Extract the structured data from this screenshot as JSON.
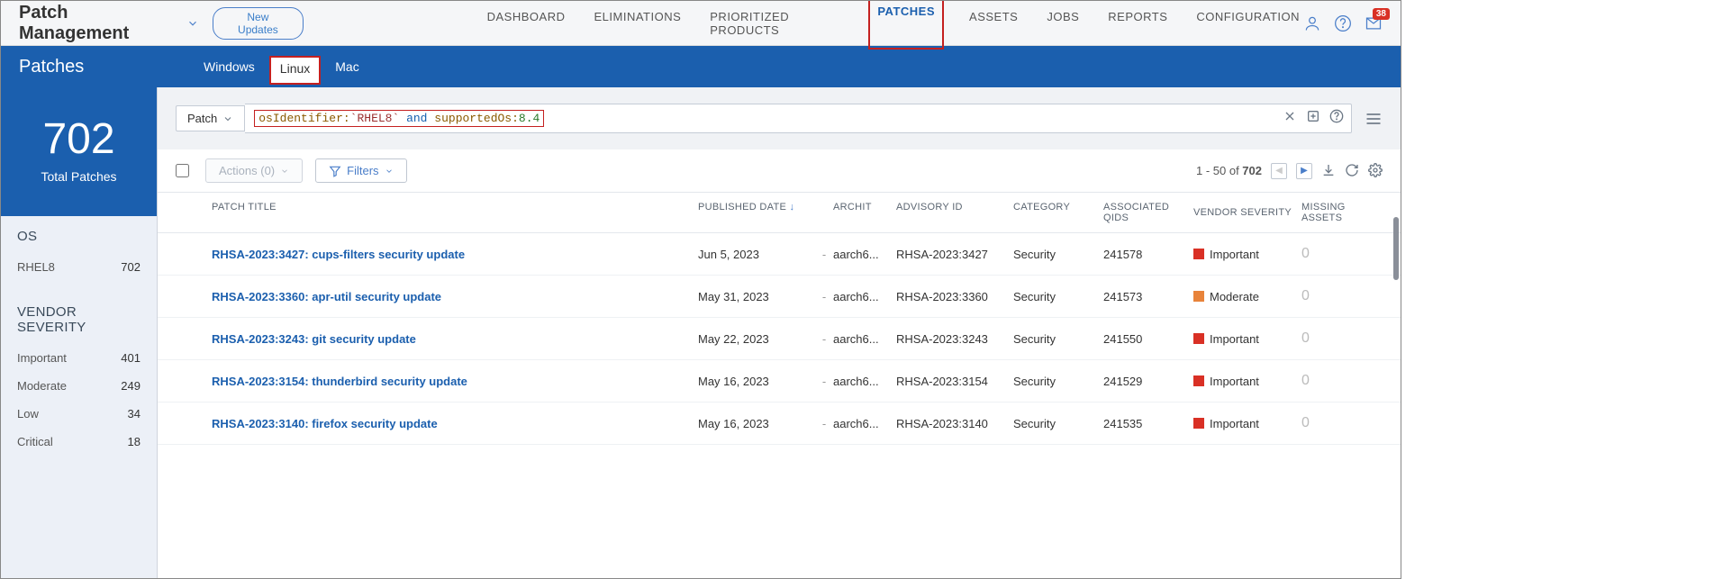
{
  "header": {
    "app_title": "Patch Management",
    "new_updates_label": "New Updates",
    "nav_items": [
      "DASHBOARD",
      "ELIMINATIONS",
      "PRIORITIZED PRODUCTS",
      "PATCHES",
      "ASSETS",
      "JOBS",
      "REPORTS",
      "CONFIGURATION"
    ],
    "active_nav": "PATCHES",
    "notification_count": "38"
  },
  "blue_bar": {
    "title": "Patches",
    "tabs": [
      "Windows",
      "Linux",
      "Mac"
    ],
    "active_tab": "Linux"
  },
  "sidebar": {
    "summary": {
      "count": "702",
      "label": "Total Patches"
    },
    "facets": [
      {
        "title": "OS",
        "items": [
          {
            "label": "RHEL8",
            "count": "702"
          }
        ]
      },
      {
        "title": "VENDOR SEVERITY",
        "items": [
          {
            "label": "Important",
            "count": "401"
          },
          {
            "label": "Moderate",
            "count": "249"
          },
          {
            "label": "Low",
            "count": "34"
          },
          {
            "label": "Critical",
            "count": "18"
          }
        ]
      }
    ]
  },
  "search": {
    "scope_label": "Patch",
    "query_parts": {
      "field1": "osIdentifier:",
      "val1": "`RHEL8`",
      "op": " and ",
      "field2": "supportedOs:",
      "val2": "8.4"
    }
  },
  "toolbar": {
    "actions_label": "Actions (0)",
    "filters_label": "Filters",
    "pagination": {
      "range": "1 - 50 of ",
      "total": "702"
    }
  },
  "table": {
    "columns": [
      "PATCH TITLE",
      "PUBLISHED DATE",
      "ARCHIT",
      "ADVISORY ID",
      "CATEGORY",
      "ASSOCIATED QIDS",
      "VENDOR SEVERITY",
      "MISSING ASSETS"
    ],
    "rows": [
      {
        "title": "RHSA-2023:3427: cups-filters security update",
        "published": "Jun 5, 2023",
        "arch": "aarch6...",
        "advisory": "RHSA-2023:3427",
        "category": "Security",
        "qid": "241578",
        "severity": "Important",
        "sev_class": "sev-important",
        "missing": "0"
      },
      {
        "title": "RHSA-2023:3360: apr-util security update",
        "published": "May 31, 2023",
        "arch": "aarch6...",
        "advisory": "RHSA-2023:3360",
        "category": "Security",
        "qid": "241573",
        "severity": "Moderate",
        "sev_class": "sev-moderate",
        "missing": "0"
      },
      {
        "title": "RHSA-2023:3243: git security update",
        "published": "May 22, 2023",
        "arch": "aarch6...",
        "advisory": "RHSA-2023:3243",
        "category": "Security",
        "qid": "241550",
        "severity": "Important",
        "sev_class": "sev-important",
        "missing": "0"
      },
      {
        "title": "RHSA-2023:3154: thunderbird security update",
        "published": "May 16, 2023",
        "arch": "aarch6...",
        "advisory": "RHSA-2023:3154",
        "category": "Security",
        "qid": "241529",
        "severity": "Important",
        "sev_class": "sev-important",
        "missing": "0"
      },
      {
        "title": "RHSA-2023:3140: firefox security update",
        "published": "May 16, 2023",
        "arch": "aarch6...",
        "advisory": "RHSA-2023:3140",
        "category": "Security",
        "qid": "241535",
        "severity": "Important",
        "sev_class": "sev-important",
        "missing": "0"
      }
    ]
  }
}
